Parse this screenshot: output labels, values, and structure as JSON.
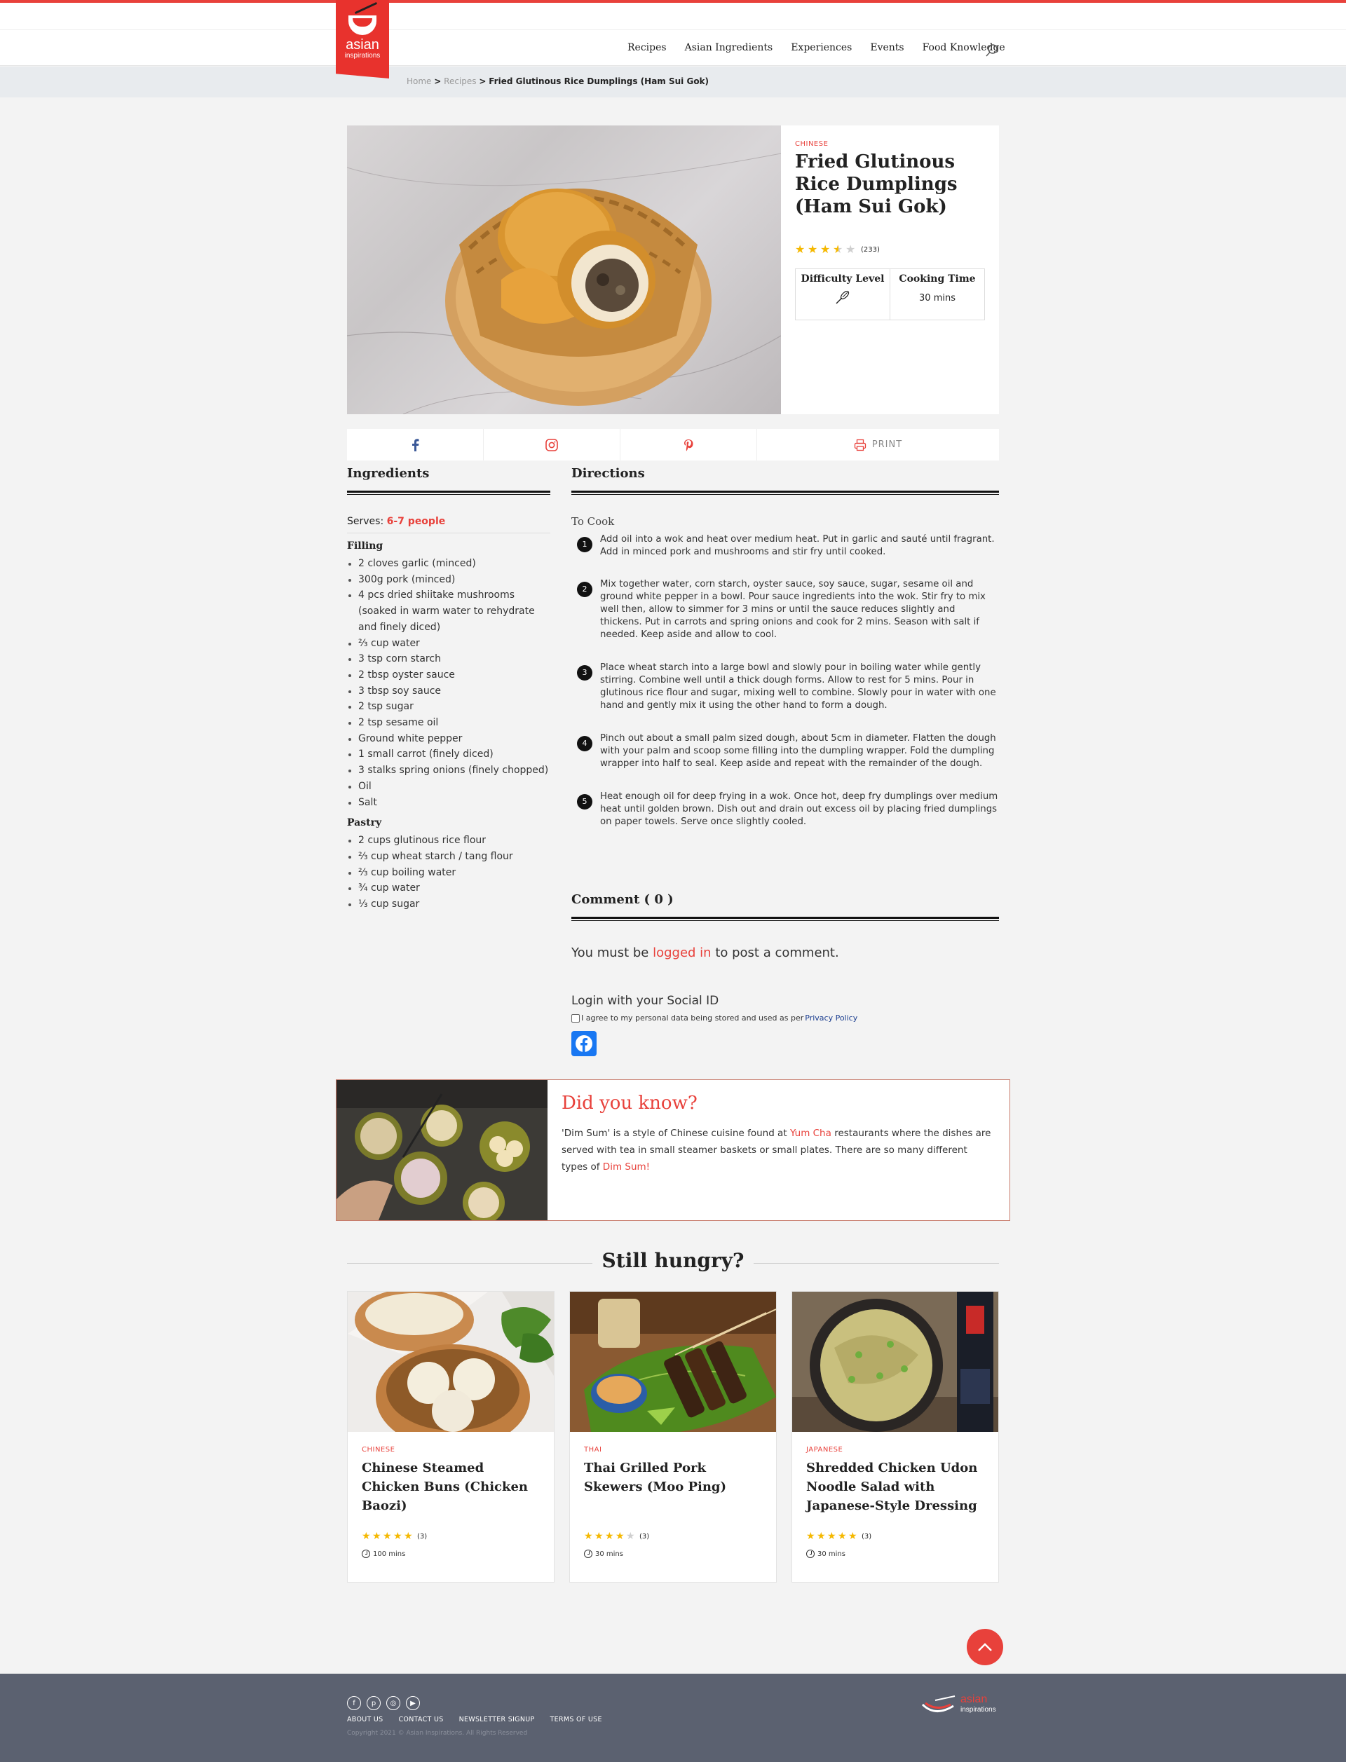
{
  "header": {
    "logo_line1": "asian",
    "logo_line2": "inspirations",
    "nav": [
      "Recipes",
      "Asian Ingredients",
      "Experiences",
      "Events",
      "Food Knowledge"
    ]
  },
  "breadcrumb": {
    "home": "Home",
    "sep": ">",
    "recipes": "Recipes",
    "current": "Fried Glutinous Rice Dumplings (Ham Sui Gok)"
  },
  "recipe": {
    "cuisine": "CHINESE",
    "title": "Fried Glutinous Rice Dumplings (Ham Sui Gok)",
    "rating": 3.5,
    "rating_count": "(233)",
    "difficulty_label": "Difficulty Level",
    "cooking_time_label": "Cooking Time",
    "cooking_time": "30 mins"
  },
  "share": {
    "print_label": "PRINT"
  },
  "ingredients": {
    "title": "Ingredients",
    "serves_label": "Serves:",
    "serves_value": "6-7 people",
    "groups": [
      {
        "name": "Filling",
        "items": [
          "2 cloves garlic (minced)",
          "300g pork (minced)",
          "4 pcs dried shiitake mushrooms (soaked in warm water to rehydrate and finely diced)",
          "⅔ cup water",
          "3 tsp corn starch",
          "2 tbsp oyster sauce",
          "3 tbsp soy sauce",
          "2 tsp sugar",
          "2 tsp sesame oil",
          "Ground white pepper",
          "1 small carrot (finely diced)",
          "3 stalks spring onions (finely chopped)",
          "Oil",
          "Salt"
        ]
      },
      {
        "name": "Pastry",
        "items": [
          "2 cups glutinous rice flour",
          "⅔ cup wheat starch / tang flour",
          "⅔ cup boiling water",
          "¾ cup water",
          "⅓ cup sugar"
        ]
      }
    ]
  },
  "directions": {
    "title": "Directions",
    "subtitle": "To Cook",
    "steps": [
      {
        "num": "1",
        "text": "Add oil into a wok and heat over medium heat. Put in garlic and sauté until fragrant. Add in minced pork and mushrooms and stir fry until cooked."
      },
      {
        "num": "2",
        "text": "Mix together water, corn starch, oyster sauce, soy sauce, sugar, sesame oil and ground white pepper in a bowl. Pour sauce ingredients into the wok. Stir fry to mix well then, allow to simmer for 3 mins or until the sauce reduces slightly and thickens. Put in carrots and spring onions and cook for 2 mins. Season with salt if needed. Keep aside and allow to cool."
      },
      {
        "num": "3",
        "text": "Place wheat starch into a large bowl and slowly pour in boiling water while gently stirring. Combine well until a thick dough forms. Allow to rest for 5 mins. Pour in glutinous rice flour and sugar, mixing well to combine. Slowly pour in water with one hand and gently mix it using the other hand to form a dough."
      },
      {
        "num": "4",
        "text": "Pinch out about a small palm sized dough, about 5cm in diameter. Flatten the dough with your palm and scoop some filling into the dumpling wrapper. Fold the dumpling wrapper into half to seal. Keep aside and repeat with the remainder of the dough."
      },
      {
        "num": "5",
        "text": "Heat enough oil for deep frying in a wok. Once hot, deep fry dumplings over medium heat until golden brown. Dish out and drain out excess oil by placing fried dumplings on paper towels. Serve once slightly cooled."
      }
    ]
  },
  "comments": {
    "title": "Comment ( 0 )",
    "must_prefix": "You must be",
    "must_link": "logged in",
    "must_suffix": "to post a comment.",
    "login_title": "Login with your Social ID",
    "agree_text": "I agree to my personal data being stored and used as per",
    "privacy_link": "Privacy Policy"
  },
  "did_you_know": {
    "title": "Did you know?",
    "t1": "'Dim Sum' is a style of Chinese cuisine found at",
    "link1": "Yum Cha",
    "t2": "restaurants where the dishes are served with tea in small steamer baskets or small plates. There are so many different types of",
    "link2": "Dim Sum!"
  },
  "still_hungry": {
    "title": "Still hungry?",
    "cards": [
      {
        "cuisine": "CHINESE",
        "title": "Chinese Steamed Chicken Buns (Chicken Baozi)",
        "rating": 5,
        "count": "(3)",
        "time": "100 mins"
      },
      {
        "cuisine": "THAI",
        "title": "Thai Grilled Pork Skewers (Moo Ping)",
        "rating": 4,
        "count": "(3)",
        "time": "30 mins"
      },
      {
        "cuisine": "JAPANESE",
        "title": "Shredded Chicken Udon Noodle Salad with Japanese-Style Dressing",
        "rating": 5,
        "count": "(3)",
        "time": "30 mins"
      }
    ]
  },
  "footer": {
    "links": [
      "ABOUT US",
      "CONTACT US",
      "NEWSLETTER SIGNUP",
      "TERMS OF USE"
    ],
    "copyright": "Copyright 2021 © Asian Inspirations. All Rights Reserved",
    "logo_line1": "asian",
    "logo_line2": "inspirations"
  },
  "colors": {
    "accent": "#e8413b",
    "footer_bg": "#5b6170",
    "star": "#f5b800"
  }
}
